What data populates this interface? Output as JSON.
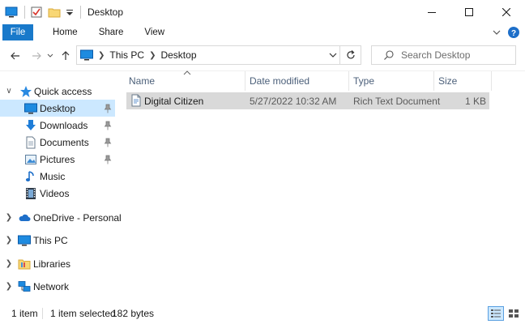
{
  "window": {
    "title": "Desktop"
  },
  "ribbon": {
    "tabs": [
      {
        "label": "File"
      },
      {
        "label": "Home"
      },
      {
        "label": "Share"
      },
      {
        "label": "View"
      }
    ]
  },
  "address": {
    "crumbs": [
      "This PC",
      "Desktop"
    ]
  },
  "search": {
    "placeholder": "Search Desktop"
  },
  "navpane": {
    "items": [
      {
        "label": "Quick access",
        "icon": "star-icon"
      },
      {
        "label": "Desktop",
        "icon": "desktop-icon",
        "selected": true,
        "pinned": true
      },
      {
        "label": "Downloads",
        "icon": "download-arrow-icon",
        "pinned": true
      },
      {
        "label": "Documents",
        "icon": "document-icon",
        "pinned": true
      },
      {
        "label": "Pictures",
        "icon": "picture-icon",
        "pinned": true
      },
      {
        "label": "Music",
        "icon": "music-note-icon"
      },
      {
        "label": "Videos",
        "icon": "film-icon"
      },
      {
        "label": "OneDrive - Personal",
        "icon": "cloud-icon"
      },
      {
        "label": "This PC",
        "icon": "monitor-icon"
      },
      {
        "label": "Libraries",
        "icon": "folder-icon"
      },
      {
        "label": "Network",
        "icon": "network-icon"
      }
    ]
  },
  "columns": {
    "name": "Name",
    "date": "Date modified",
    "type": "Type",
    "size": "Size"
  },
  "files": [
    {
      "name": "Digital Citizen",
      "date": "5/27/2022 10:32 AM",
      "type": "Rich Text Document",
      "size": "1 KB",
      "icon": "rtf-file-icon"
    }
  ],
  "status": {
    "count": "1 item",
    "selected": "1 item selected",
    "bytes": "182 bytes"
  },
  "colors": {
    "accent": "#1979ca",
    "selection": "#cce8ff",
    "row_selected": "#d9d9d9",
    "column_header_text": "#4c607a"
  }
}
